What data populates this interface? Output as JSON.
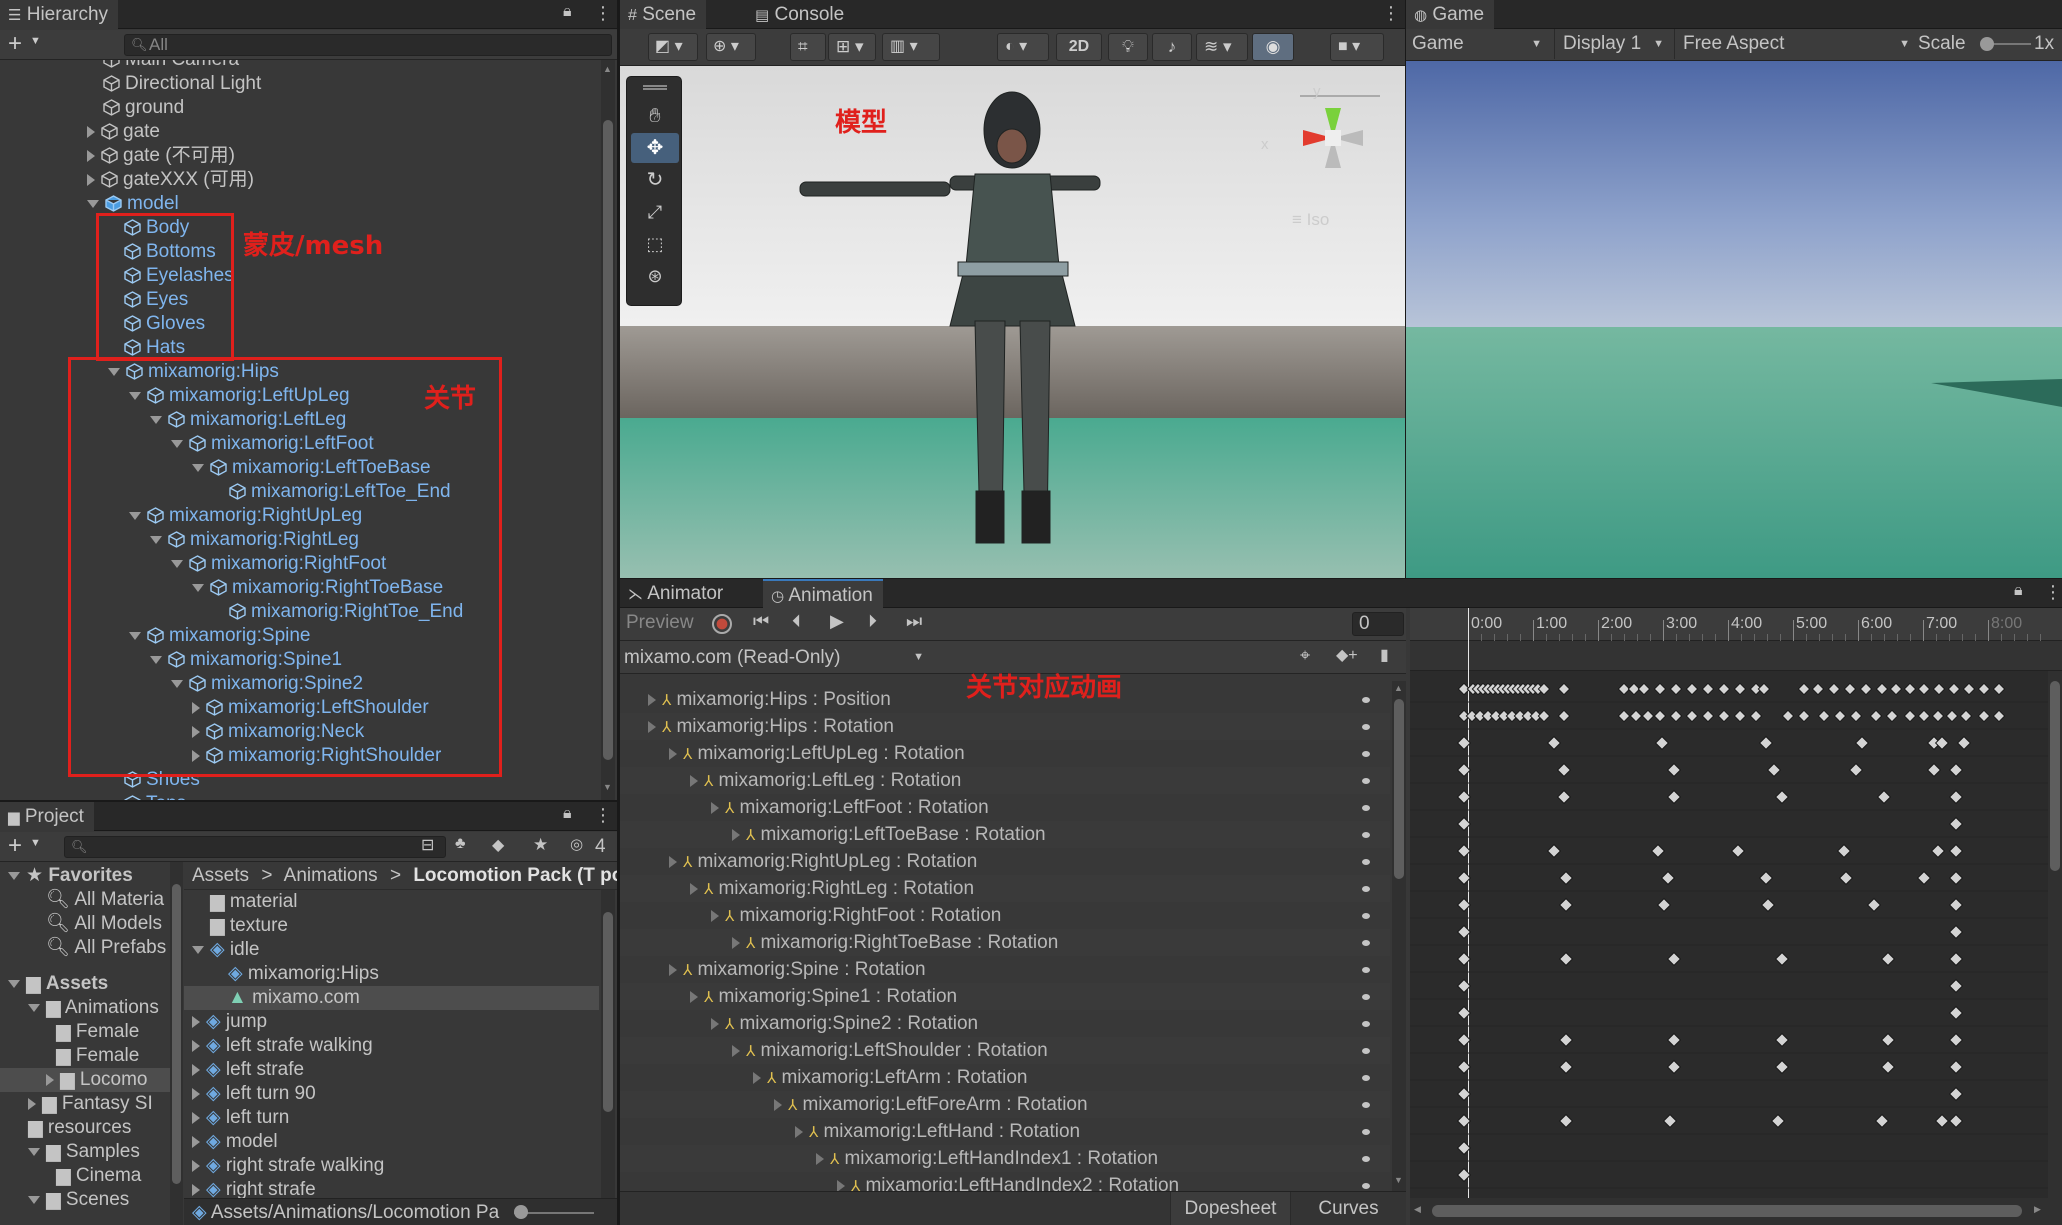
{
  "hierarchy": {
    "title": "Hierarchy",
    "search_placeholder": "All",
    "add_label": "+",
    "items": [
      {
        "label": "Main Camera"
      },
      {
        "label": "Directional Light"
      },
      {
        "label": "ground"
      },
      {
        "label": "gate"
      },
      {
        "label": "gate (不可用)"
      },
      {
        "label": "gateXXX (可用)"
      },
      {
        "label": "model"
      },
      {
        "label": "Body"
      },
      {
        "label": "Bottoms"
      },
      {
        "label": "Eyelashes"
      },
      {
        "label": "Eyes"
      },
      {
        "label": "Gloves"
      },
      {
        "label": "Hats"
      },
      {
        "label": "mixamorig:Hips"
      },
      {
        "label": "mixamorig:LeftUpLeg"
      },
      {
        "label": "mixamorig:LeftLeg"
      },
      {
        "label": "mixamorig:LeftFoot"
      },
      {
        "label": "mixamorig:LeftToeBase"
      },
      {
        "label": "mixamorig:LeftToe_End"
      },
      {
        "label": "mixamorig:RightUpLeg"
      },
      {
        "label": "mixamorig:RightLeg"
      },
      {
        "label": "mixamorig:RightFoot"
      },
      {
        "label": "mixamorig:RightToeBase"
      },
      {
        "label": "mixamorig:RightToe_End"
      },
      {
        "label": "mixamorig:Spine"
      },
      {
        "label": "mixamorig:Spine1"
      },
      {
        "label": "mixamorig:Spine2"
      },
      {
        "label": "mixamorig:LeftShoulder"
      },
      {
        "label": "mixamorig:Neck"
      },
      {
        "label": "mixamorig:RightShoulder"
      },
      {
        "label": "Shoes"
      },
      {
        "label": "Tops"
      }
    ]
  },
  "annotations": {
    "mesh": "蒙皮/mesh",
    "joints": "关节",
    "model": "模型",
    "joint_anim": "关节对应动画"
  },
  "scene": {
    "tab_scene": "Scene",
    "tab_console": "Console",
    "btn_2d": "2D",
    "iso": "Iso",
    "axis_x": "x",
    "axis_y": "y"
  },
  "game": {
    "tab": "Game",
    "mode": "Game",
    "display": "Display 1",
    "aspect": "Free Aspect",
    "scale_label": "Scale",
    "scale_value": "1x"
  },
  "project": {
    "title": "Project",
    "count": "4",
    "breadcrumb": [
      "Assets",
      ">",
      "Animations",
      ">",
      "Locomotion Pack  (T pos"
    ],
    "favorites": {
      "label": "Favorites",
      "items": [
        "All Materia",
        "All Models",
        "All Prefabs"
      ]
    },
    "tree": {
      "label": "Assets",
      "items": [
        "Animations",
        "Female",
        "Female",
        "Locomo",
        "Fantasy SI",
        "resources",
        "Samples",
        "Cinema",
        "Scenes"
      ]
    },
    "files": [
      "material",
      "texture",
      "idle",
      "mixamorig:Hips",
      "mixamo.com",
      "jump",
      "left strafe walking",
      "left strafe",
      "left turn 90",
      "left turn",
      "model",
      "right strafe walking",
      "right strafe"
    ],
    "status_path": "Assets/Animations/Locomotion Pa"
  },
  "animation": {
    "tab_animator": "Animator",
    "tab_animation": "Animation",
    "preview": "Preview",
    "frame": "0",
    "clip": "mixamo.com (Read-Only)",
    "time_labels": [
      "0:00",
      "1:00",
      "2:00",
      "3:00",
      "4:00",
      "5:00",
      "6:00",
      "7:00",
      "8:00"
    ],
    "properties": [
      {
        "label": "mixamorig:Hips : Position"
      },
      {
        "label": "mixamorig:Hips : Rotation"
      },
      {
        "label": "mixamorig:LeftUpLeg : Rotation"
      },
      {
        "label": "mixamorig:LeftLeg : Rotation"
      },
      {
        "label": "mixamorig:LeftFoot : Rotation"
      },
      {
        "label": "mixamorig:LeftToeBase : Rotation"
      },
      {
        "label": "mixamorig:RightUpLeg : Rotation"
      },
      {
        "label": "mixamorig:RightLeg : Rotation"
      },
      {
        "label": "mixamorig:RightFoot : Rotation"
      },
      {
        "label": "mixamorig:RightToeBase : Rotation"
      },
      {
        "label": "mixamorig:Spine : Rotation"
      },
      {
        "label": "mixamorig:Spine1 : Rotation"
      },
      {
        "label": "mixamorig:Spine2 : Rotation"
      },
      {
        "label": "mixamorig:LeftShoulder : Rotation"
      },
      {
        "label": "mixamorig:LeftArm : Rotation"
      },
      {
        "label": "mixamorig:LeftForeArm : Rotation"
      },
      {
        "label": "mixamorig:LeftHand : Rotation"
      },
      {
        "label": "mixamorig:LeftHandIndex1 : Rotation"
      },
      {
        "label": "mixamorig:LeftHandIndex2 : Rotation"
      }
    ],
    "dopesheet": "Dopesheet",
    "curves": "Curves"
  },
  "colors": {
    "accent": "#3a79bb",
    "annotation_red": "#e0201c",
    "selected_text": "#7fb5ee"
  }
}
